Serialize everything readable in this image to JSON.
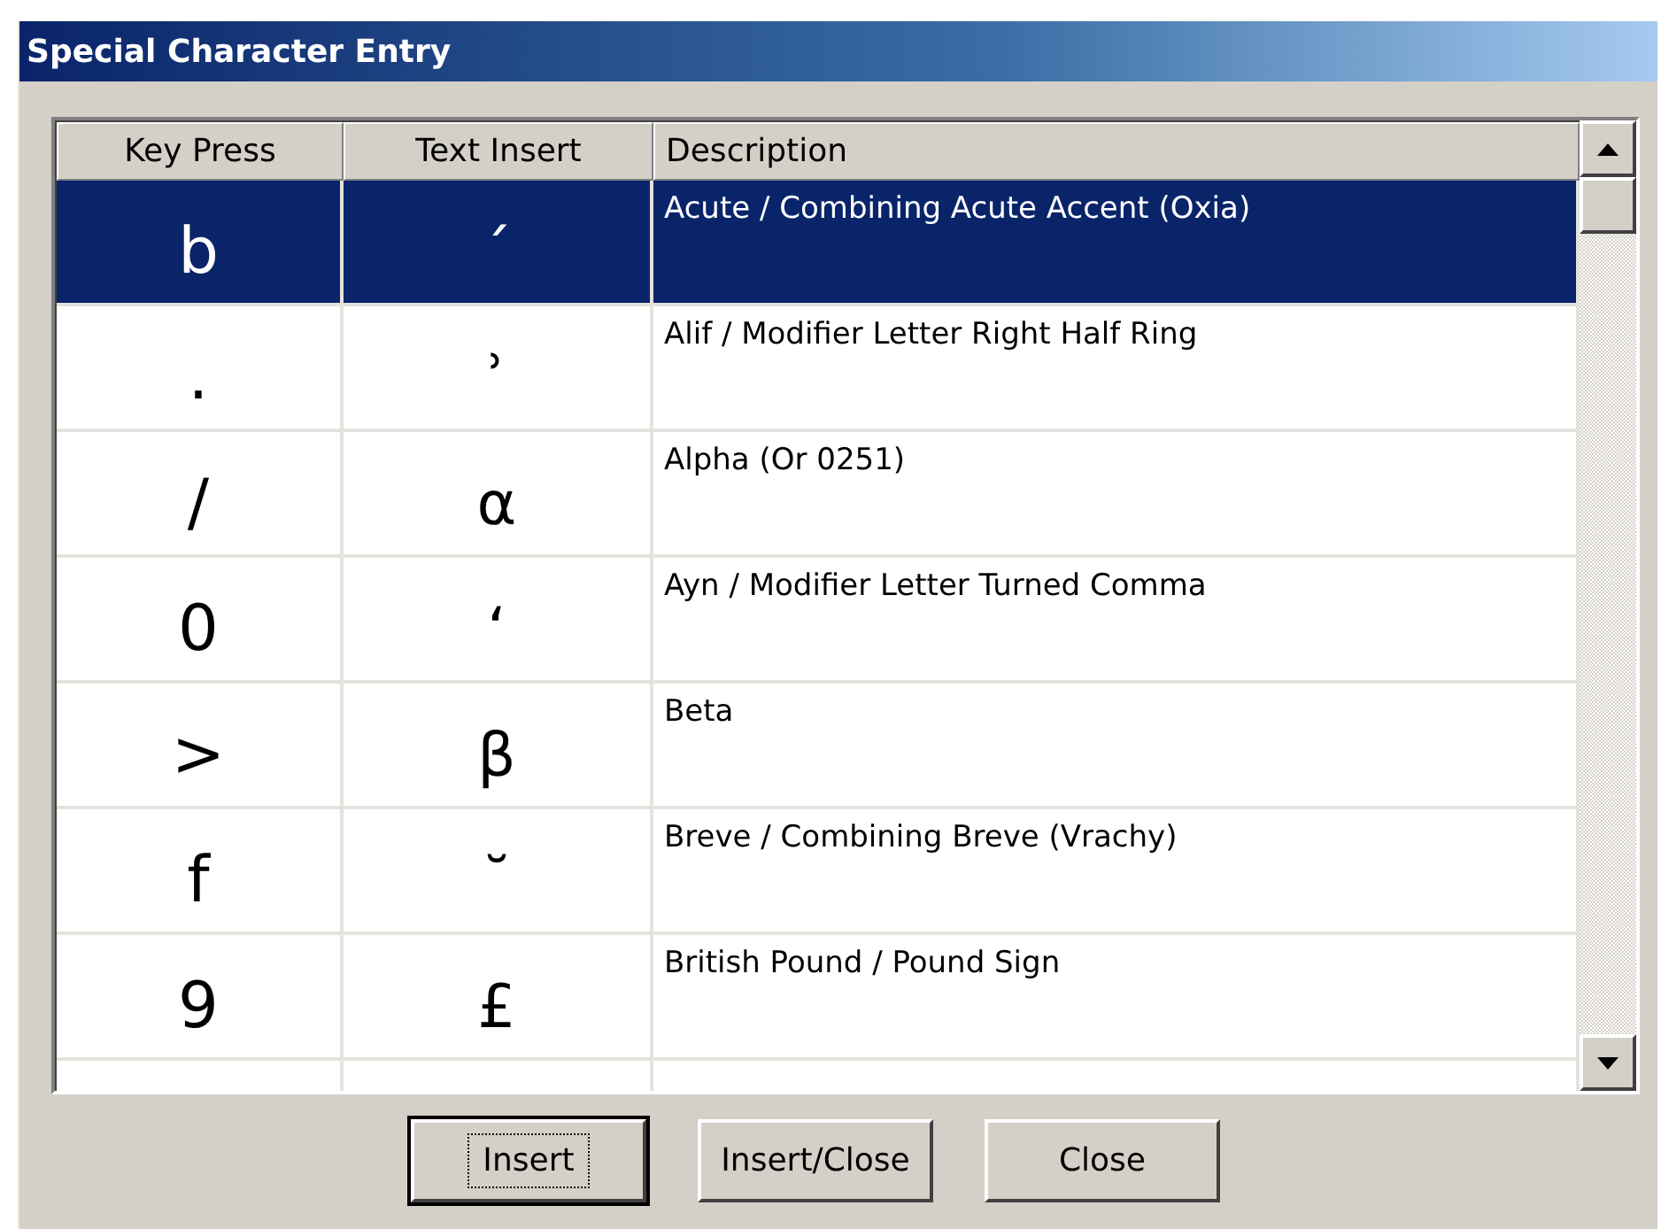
{
  "window": {
    "title": "Special Character Entry"
  },
  "table": {
    "columns": [
      "Key Press",
      "Text Insert",
      "Description"
    ],
    "rows": [
      {
        "key_press": "b",
        "text_insert": "´",
        "description": "Acute / Combining Acute Accent (Oxia)",
        "selected": true
      },
      {
        "key_press": ".",
        "text_insert": "ʾ",
        "description": "Alif / Modifier Letter Right Half Ring",
        "selected": false
      },
      {
        "key_press": "/",
        "text_insert": "α",
        "description": "Alpha (Or 0251)",
        "selected": false
      },
      {
        "key_press": "0",
        "text_insert": "ʻ",
        "description": "Ayn / Modifier Letter Turned Comma",
        "selected": false
      },
      {
        "key_press": ">",
        "text_insert": "β",
        "description": "Beta",
        "selected": false
      },
      {
        "key_press": "f",
        "text_insert": "˘",
        "description": "Breve / Combining Breve (Vrachy)",
        "selected": false
      },
      {
        "key_press": "9",
        "text_insert": "£",
        "description": "British Pound / Pound Sign",
        "selected": false
      }
    ]
  },
  "buttons": [
    {
      "label": "Insert",
      "focused": true
    },
    {
      "label": "Insert/Close",
      "focused": false
    },
    {
      "label": "Close",
      "focused": false
    }
  ]
}
